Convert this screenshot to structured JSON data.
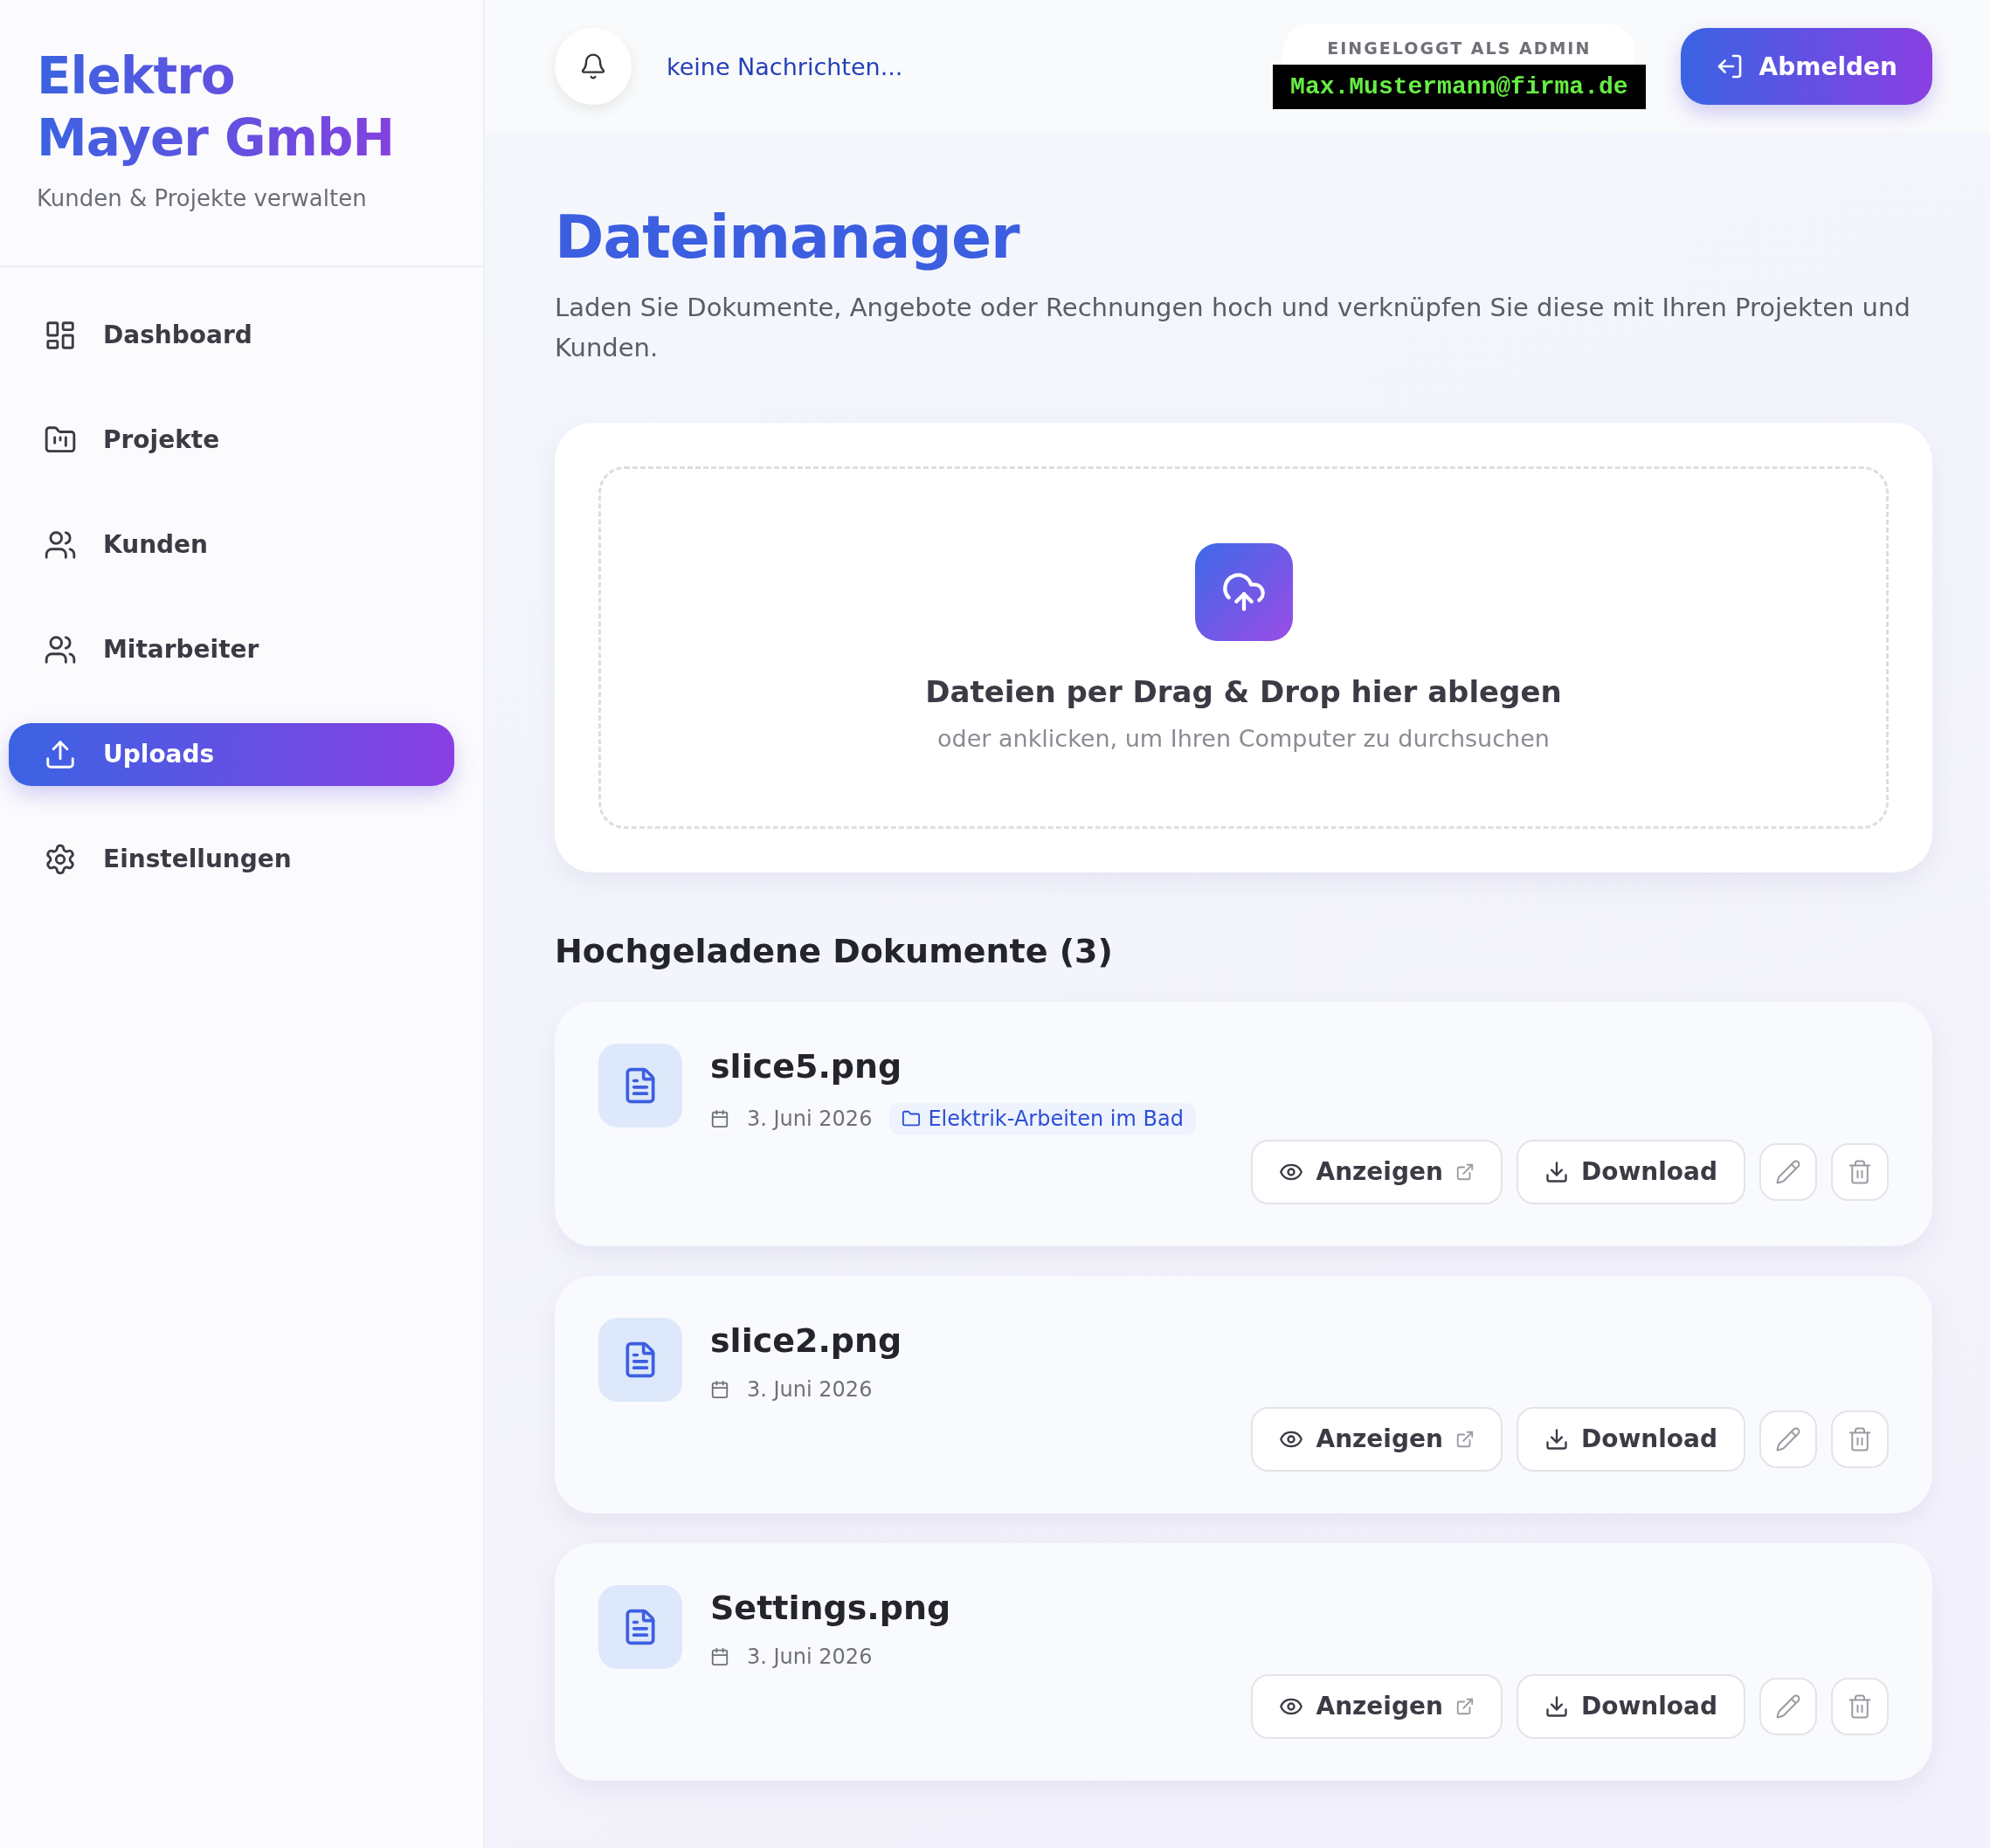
{
  "brand": {
    "name": "Elektro Mayer GmbH",
    "tagline": "Kunden & Projekte verwalten"
  },
  "sidebar": {
    "items": [
      {
        "label": "Dashboard",
        "selected": false
      },
      {
        "label": "Projekte",
        "selected": false
      },
      {
        "label": "Kunden",
        "selected": false
      },
      {
        "label": "Mitarbeiter",
        "selected": false
      },
      {
        "label": "Uploads",
        "selected": true
      },
      {
        "label": "Einstellungen",
        "selected": false
      }
    ]
  },
  "topbar": {
    "notifications": "keine Nachrichten...",
    "login_label": "EINGELOGGT ALS ADMIN",
    "user_email": "Max.Mustermann@firma.de",
    "logout": "Abmelden"
  },
  "page": {
    "title": "Dateimanager",
    "description": "Laden Sie Dokumente, Angebote oder Rechnungen hoch und verknüpfen Sie diese mit Ihren Projekten und Kunden."
  },
  "dropzone": {
    "title": "Dateien per Drag & Drop hier ablegen",
    "subtitle": "oder anklicken, um Ihren Computer zu durchsuchen"
  },
  "documents": {
    "heading": "Hochgeladene Dokumente (3)",
    "items": [
      {
        "name": "slice5.png",
        "date": "3. Juni 2026",
        "project": "Elektrik-Arbeiten im Bad",
        "view": "Anzeigen",
        "download": "Download"
      },
      {
        "name": "slice2.png",
        "date": "3. Juni 2026",
        "view": "Anzeigen",
        "download": "Download"
      },
      {
        "name": "Settings.png",
        "date": "3. Juni 2026",
        "view": "Anzeigen",
        "download": "Download"
      }
    ]
  }
}
